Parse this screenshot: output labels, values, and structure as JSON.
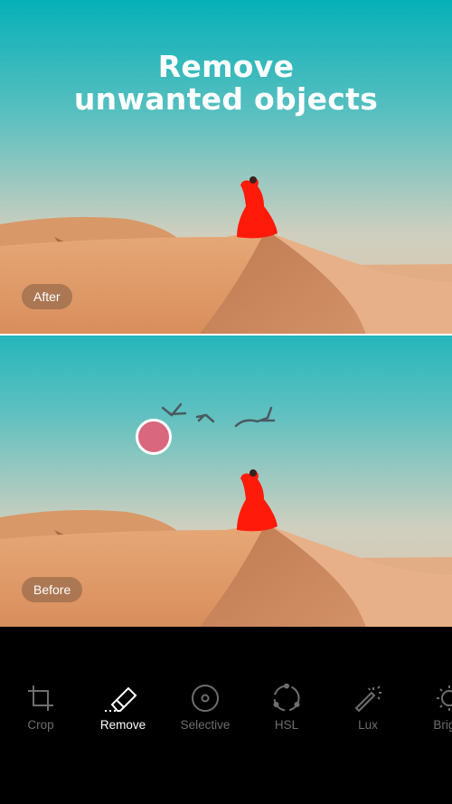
{
  "headline": {
    "line1": "Remove",
    "line2": "unwanted objects"
  },
  "after_panel": {
    "label": "After"
  },
  "before_panel": {
    "label": "Before"
  },
  "toolbar": {
    "active": "Remove",
    "items": [
      {
        "label": "Crop",
        "icon": "crop-icon"
      },
      {
        "label": "Remove",
        "icon": "eraser-icon"
      },
      {
        "label": "Selective",
        "icon": "selective-icon"
      },
      {
        "label": "HSL",
        "icon": "hsl-icon"
      },
      {
        "label": "Lux",
        "icon": "magic-wand-icon"
      },
      {
        "label": "Bright",
        "icon": "sun-icon"
      }
    ]
  },
  "colors": {
    "brush": "#d9677e",
    "dress": "#ff1a0a",
    "sky_top": "#0fb3bb",
    "sand": "#e8a46e"
  }
}
